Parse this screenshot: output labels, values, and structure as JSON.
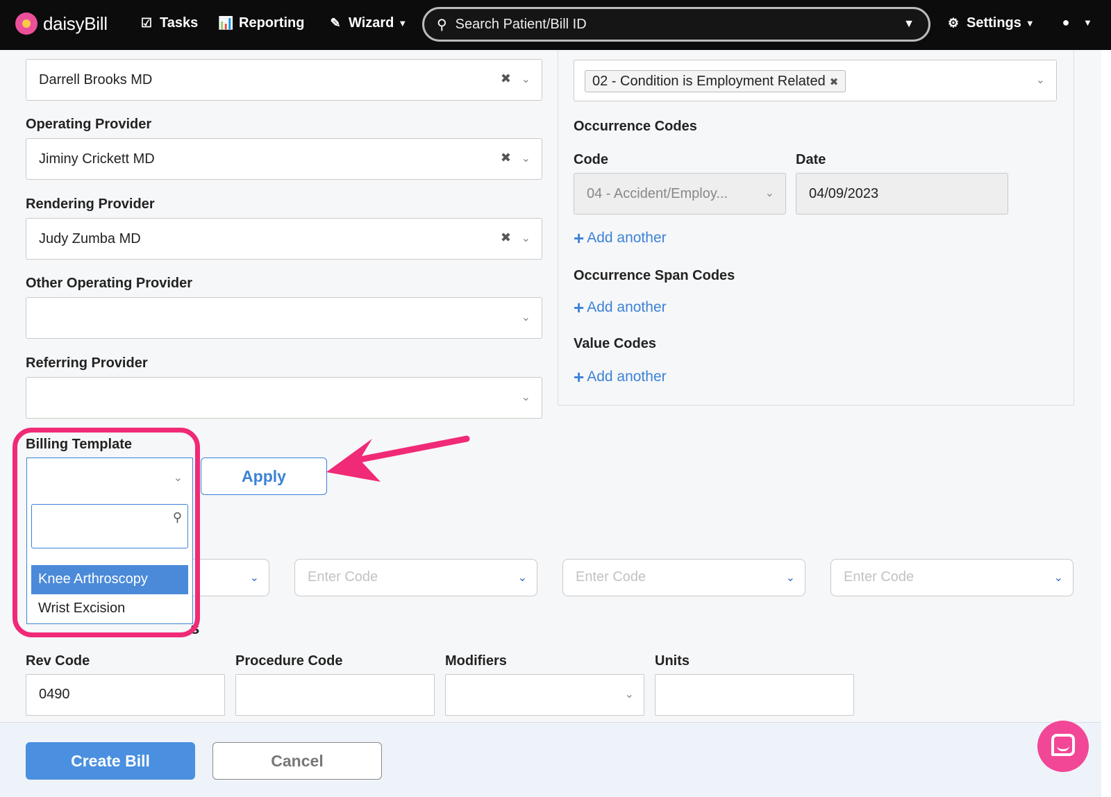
{
  "nav": {
    "brand": "daisyBill",
    "tasks": "Tasks",
    "reporting": "Reporting",
    "wizard": "Wizard",
    "search_placeholder": "Search Patient/Bill ID",
    "settings": "Settings"
  },
  "providers": {
    "attending_value": "Darrell Brooks MD",
    "operating_label": "Operating Provider",
    "operating_value": "Jiminy Crickett MD",
    "rendering_label": "Rendering Provider",
    "rendering_value": "Judy Zumba MD",
    "other_operating_label": "Other Operating Provider",
    "other_operating_value": "",
    "referring_label": "Referring Provider",
    "referring_value": ""
  },
  "codes": {
    "condition_tag": "02 - Condition is Employment Related",
    "occurrence_label": "Occurrence Codes",
    "code_label": "Code",
    "date_label": "Date",
    "occurrence_code_value": "04 - Accident/Employ...",
    "occurrence_date_value": "04/09/2023",
    "add_another": "Add another",
    "occurrence_span_label": "Occurrence Span Codes",
    "value_codes_label": "Value Codes"
  },
  "billing_template": {
    "label": "Billing Template",
    "apply": "Apply",
    "options": [
      "Knee Arthroscopy",
      "Wrist Excision"
    ],
    "selected": "Knee Arthroscopy"
  },
  "diagnosis": {
    "placeholder": "Enter Code"
  },
  "line_items": {
    "section_title_partial": "s",
    "rev_code_label": "Rev Code",
    "rev_code_value": "0490",
    "procedure_label": "Procedure Code",
    "modifiers_label": "Modifiers",
    "units_label": "Units"
  },
  "footer": {
    "create": "Create Bill",
    "cancel": "Cancel"
  },
  "colors": {
    "accent": "#3b82d6",
    "highlight": "#f02a77",
    "nav_bg": "#0c0c0c"
  }
}
